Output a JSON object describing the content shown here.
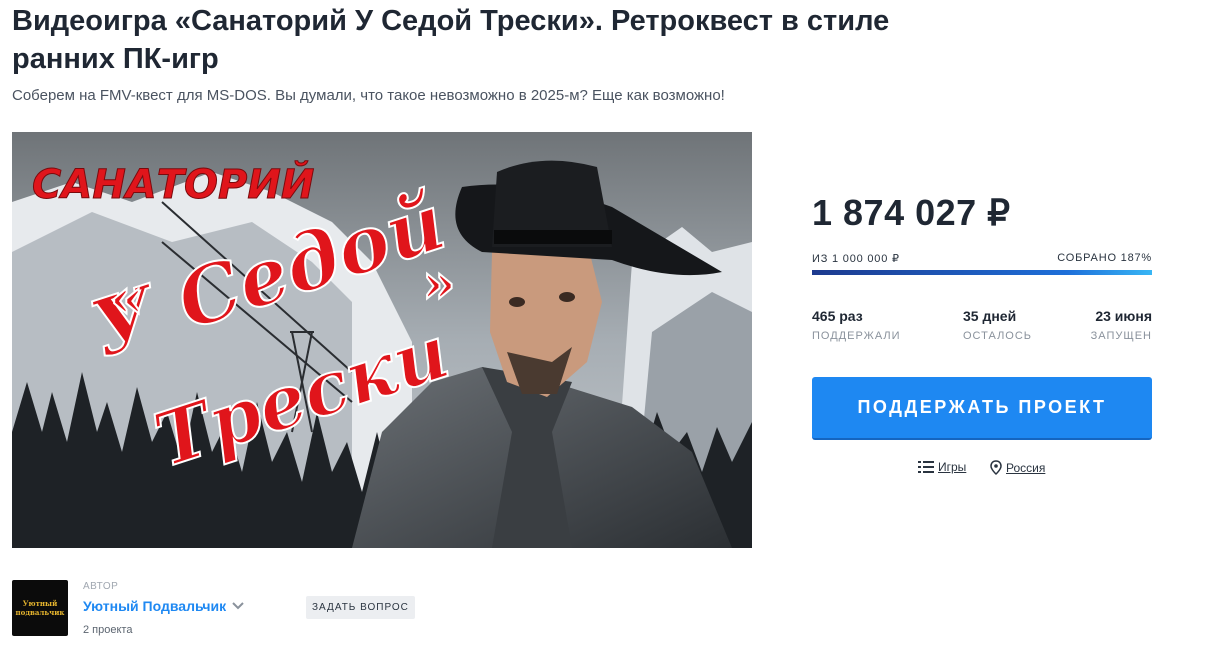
{
  "project": {
    "title": "Видеоигра «Санаторий У Седой Трески». Ретроквест в стиле ранних ПК-игр",
    "subtitle": "Соберем на FMV-квест для MS-DOS. Вы думали, что такое невозможно в 2025-м? Еще как возможно!"
  },
  "cover": {
    "logo_line1": "САНАТОРИЙ",
    "logo_line2": "У Седой",
    "logo_line3": "Трески",
    "quote_open": "«",
    "quote_close": "»"
  },
  "funding": {
    "amount": "1 874 027 ₽",
    "goal": "ИЗ 1 000 000 ₽",
    "collected": "СОБРАНО 187%",
    "progress": 1.0,
    "stats": [
      {
        "value": "465 раз",
        "label": "ПОДДЕРЖАЛИ"
      },
      {
        "value": "35 дней",
        "label": "ОСТАЛОСЬ"
      },
      {
        "value": "23 июня",
        "label": "ЗАПУЩЕН"
      }
    ],
    "cta": "ПОДДЕРЖАТЬ ПРОЕКТ",
    "category": "Игры",
    "location": "Россия"
  },
  "author": {
    "label": "АВТОР",
    "name": "Уютный Подвальчик",
    "projects": "2 проекта",
    "avatar_text_line1": "Уютный",
    "avatar_text_line2": "подвальчик",
    "ask_button": "ЗАДАТЬ ВОПРОС"
  },
  "colors": {
    "accent": "#1e88f2",
    "logo_red": "#e0151b",
    "progress_start": "#1d3a8e",
    "progress_end": "#38b6f5"
  }
}
